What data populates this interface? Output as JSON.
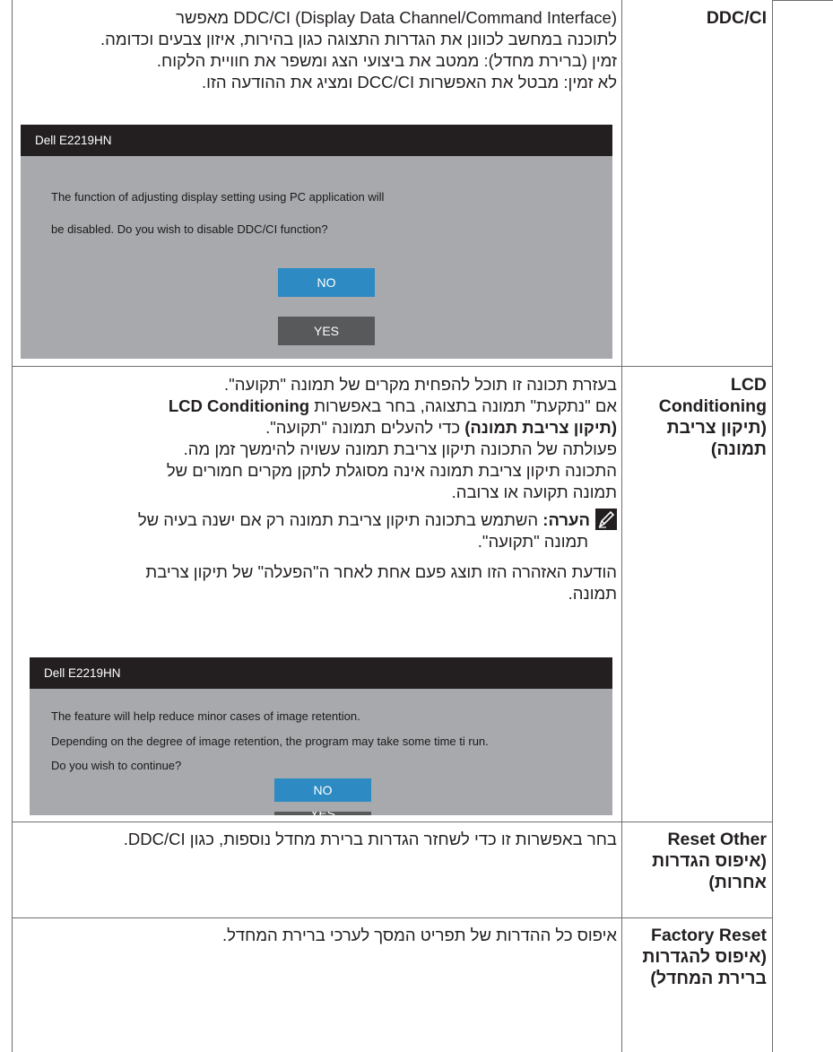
{
  "rows": {
    "ddc": {
      "label": "DDC/CI",
      "line1": "(Display Data Channel/Command Interface) DDC/CI מאפשר",
      "line2": "לתוכנה במחשב לכוונן את הגדרות התצוגה כגון בהירות, איזון צבעים וכדומה.",
      "line3": "זמין (ברירת מחדל): ממטב את ביצועי הצג ומשפר את חוויית הלקוח.",
      "line4": "לא זמין: מבטל את האפשרות DCC/CI ומציג את ההודעה הזו.",
      "dialog": {
        "title": "Dell E2219HN",
        "line1": "The function of adjusting display setting using PC application will",
        "line2": "be disabled. Do you wish to disable DDC/CI function?",
        "no": "NO",
        "yes": "YES"
      }
    },
    "lcd": {
      "label1": "LCD",
      "label2": "Conditioning",
      "label3": "(תיקון צריבת",
      "label4": "תמונה)",
      "line1": "בעזרת תכונה זו תוכל להפחית מקרים של תמונה \"תקועה\".",
      "line2_plain": "אם \"נתקעת\" תמונה בתצוגה, בחר באפשרות",
      "line2_bold": "LCD Conditioning",
      "line3_bold": "(תיקון צריבת תמונה)",
      "line3_plain": "כדי להעלים תמונה \"תקועה\".",
      "line4": "פעולתה של התכונה תיקון צריבת תמונה עשויה להימשך זמן מה.",
      "line5": "התכונה תיקון צריבת תמונה אינה מסוגלת לתקן מקרים חמורים של",
      "line6": "תמונה תקועה או צרובה.",
      "note_bold": "הערה:",
      "note_line1": "השתמש בתכונה תיקון צריבת תמונה רק אם ישנה בעיה של",
      "note_line2": "תמונה \"תקועה\".",
      "warn_line1": "הודעת האזהרה הזו תוצג פעם אחת לאחר ה\"הפעלה\" של תיקון צריבת",
      "warn_line2": "תמונה.",
      "dialog": {
        "title": "Dell E2219HN",
        "line1": "The feature will help reduce minor cases of image retention.",
        "line2": "Depending on the degree of image retention, the program may take some time ti run.",
        "line3": "Do you wish to continue?",
        "no": "NO",
        "yes": "YES"
      }
    },
    "reset_other": {
      "label1": "Reset Other",
      "label2": "(איפוס הגדרות",
      "label3": "אחרות)",
      "text": "בחר באפשרות זו כדי לשחזר הגדרות ברירת מחדל נוספות, כגון DDC/CI."
    },
    "factory": {
      "label1": "Factory Reset",
      "label2": "(איפוס להגדרות",
      "label3": "ברירת המחדל)",
      "text": "איפוס כל ההדרות של תפריט המסך לערכי ברירת המחדל."
    }
  },
  "icons": {
    "note": "pencil-note-icon"
  },
  "colors": {
    "dialog_bg": "#a7a9ac",
    "title_bar": "#231f20",
    "no_button": "#2d8ac3",
    "yes_button": "#58595b"
  }
}
